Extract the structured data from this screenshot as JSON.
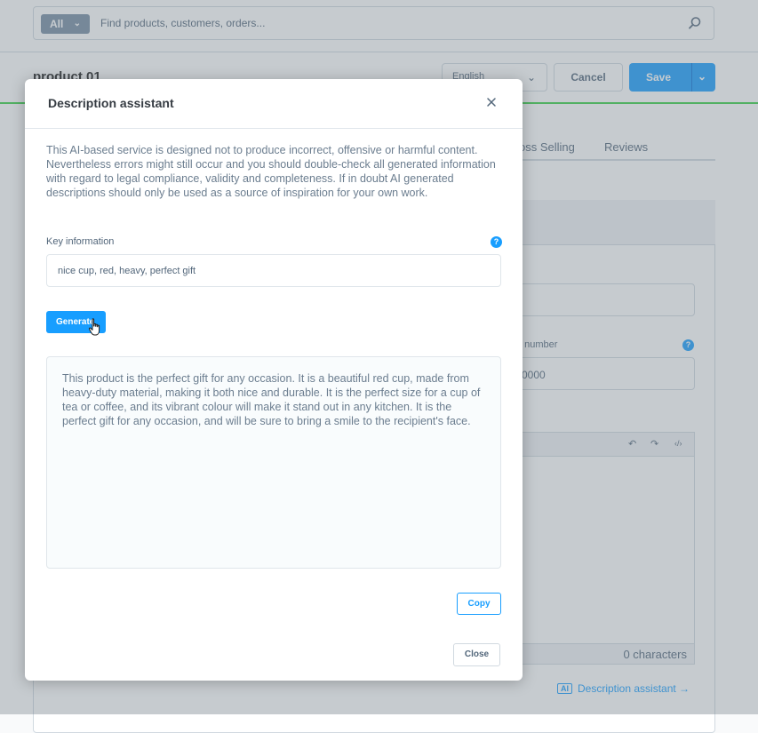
{
  "search": {
    "scope": "All",
    "placeholder": "Find products, customers, orders..."
  },
  "page": {
    "title": "product 01",
    "language": "English",
    "cancel_label": "Cancel",
    "save_label": "Save"
  },
  "tabs": [
    "oss Selling",
    "Reviews"
  ],
  "background_form": {
    "number_label": "t number",
    "number_value": "0000",
    "char_count": "0 characters",
    "ai_badge": "AI",
    "ai_link": "Description assistant →"
  },
  "modal": {
    "title": "Description assistant",
    "disclaimer": "This AI-based service is designed not to produce incorrect, offensive or harmful content. Nevertheless errors might still occur and you should double-check all generated information with regard to legal compliance, validity and completeness. If in doubt AI generated descriptions should only be used as a source of inspiration for your own work.",
    "key_label": "Key information",
    "key_value": "nice cup, red, heavy, perfect gift",
    "generate_label": "Generate",
    "result": "This product is the perfect gift for any occasion. It is a beautiful red cup, made from heavy-duty material, making it both nice and durable. It is the perfect size for a cup of tea or coffee, and its vibrant colour will make it stand out in any kitchen. It is the perfect gift for any occasion, and will be sure to bring a smile to the recipient's face.",
    "copy_label": "Copy",
    "close_label": "Close"
  },
  "colors": {
    "primary": "#189eff",
    "accent_line": "#37d046",
    "text": "#52667a"
  }
}
